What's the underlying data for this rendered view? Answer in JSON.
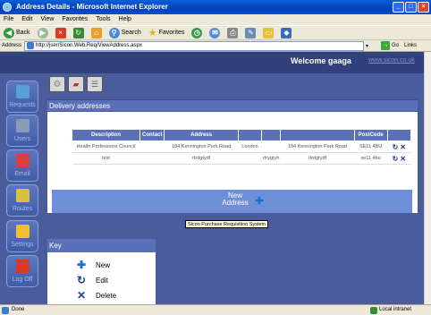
{
  "window": {
    "title": "Address Details - Microsoft Internet Explorer"
  },
  "menu": [
    "File",
    "Edit",
    "View",
    "Favorites",
    "Tools",
    "Help"
  ],
  "toolbar": {
    "back": "Back",
    "search": "Search",
    "favorites": "Favorites"
  },
  "address": {
    "label": "Address",
    "url": "http://jser/Sicon.Web.Req/ViewAddress.aspx",
    "go": "Go",
    "links": "Links"
  },
  "header": {
    "welcome": "Welcome gaaga",
    "link": "www.sicon.co.uk"
  },
  "nav": [
    {
      "label": "Requests",
      "icon": "requests-icon",
      "color": "#5aa0d8"
    },
    {
      "label": "Users",
      "icon": "users-icon",
      "color": "#8a9bb8"
    },
    {
      "label": "Email",
      "icon": "email-icon",
      "color": "#d84040"
    },
    {
      "label": "Routes",
      "icon": "routes-icon",
      "color": "#d8c040"
    },
    {
      "label": "Settings",
      "icon": "settings-icon",
      "color": "#f0c030"
    },
    {
      "label": "Log Off",
      "icon": "logoff-icon",
      "color": "#d83a2a"
    }
  ],
  "section": {
    "title": "Delivery addresses"
  },
  "table": {
    "columns": [
      "Description",
      "Contact",
      "Address",
      "",
      "",
      "",
      "PostCode",
      ""
    ],
    "rows": [
      [
        "Health Professions Council",
        "",
        "184 Kennington Park Road",
        "London",
        "",
        "184 Kennington Park Road",
        "SE11 4BU"
      ],
      [
        "test",
        "",
        "rtrdgtydf",
        "",
        "rfrygtyh",
        "rtrdgtydf",
        "se11 4bu"
      ]
    ]
  },
  "new_button": {
    "label": "New Address"
  },
  "tooltip": "Sicon Purchase Requisition System",
  "key": {
    "title": "Key",
    "items": [
      {
        "label": "New",
        "icon": "plus-icon"
      },
      {
        "label": "Edit",
        "icon": "edit-icon"
      },
      {
        "label": "Delete",
        "icon": "delete-icon"
      }
    ]
  },
  "status": {
    "left": "Done",
    "right": "Local intranet"
  },
  "colors": {
    "header": "#31417c",
    "panel": "#4b5c9c",
    "accent": "#5a70b8"
  }
}
